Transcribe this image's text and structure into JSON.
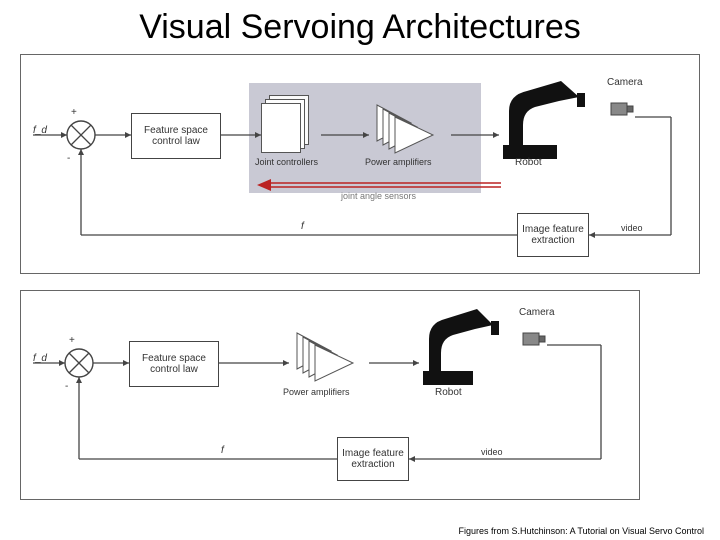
{
  "title": "Visual Servoing Architectures",
  "citation": "Figures from S.Hutchinson: A Tutorial on Visual Servo Control",
  "diagram_top": {
    "input_label": "f_d",
    "plus": "+",
    "minus": "-",
    "block_law": "Feature space control law",
    "label_joint_ctrl": "Joint controllers",
    "label_power_amp": "Power amplifiers",
    "label_robot": "Robot",
    "label_camera": "Camera",
    "label_joint_sensors": "joint angle sensors",
    "block_feature": "Image feature extraction",
    "signal_f": "f",
    "signal_video": "video"
  },
  "diagram_bottom": {
    "input_label": "f_d",
    "plus": "+",
    "minus": "-",
    "block_law": "Feature space control law",
    "label_power_amp": "Power amplifiers",
    "label_robot": "Robot",
    "label_camera": "Camera",
    "block_feature": "Image feature extraction",
    "signal_f": "f",
    "signal_video": "video"
  }
}
